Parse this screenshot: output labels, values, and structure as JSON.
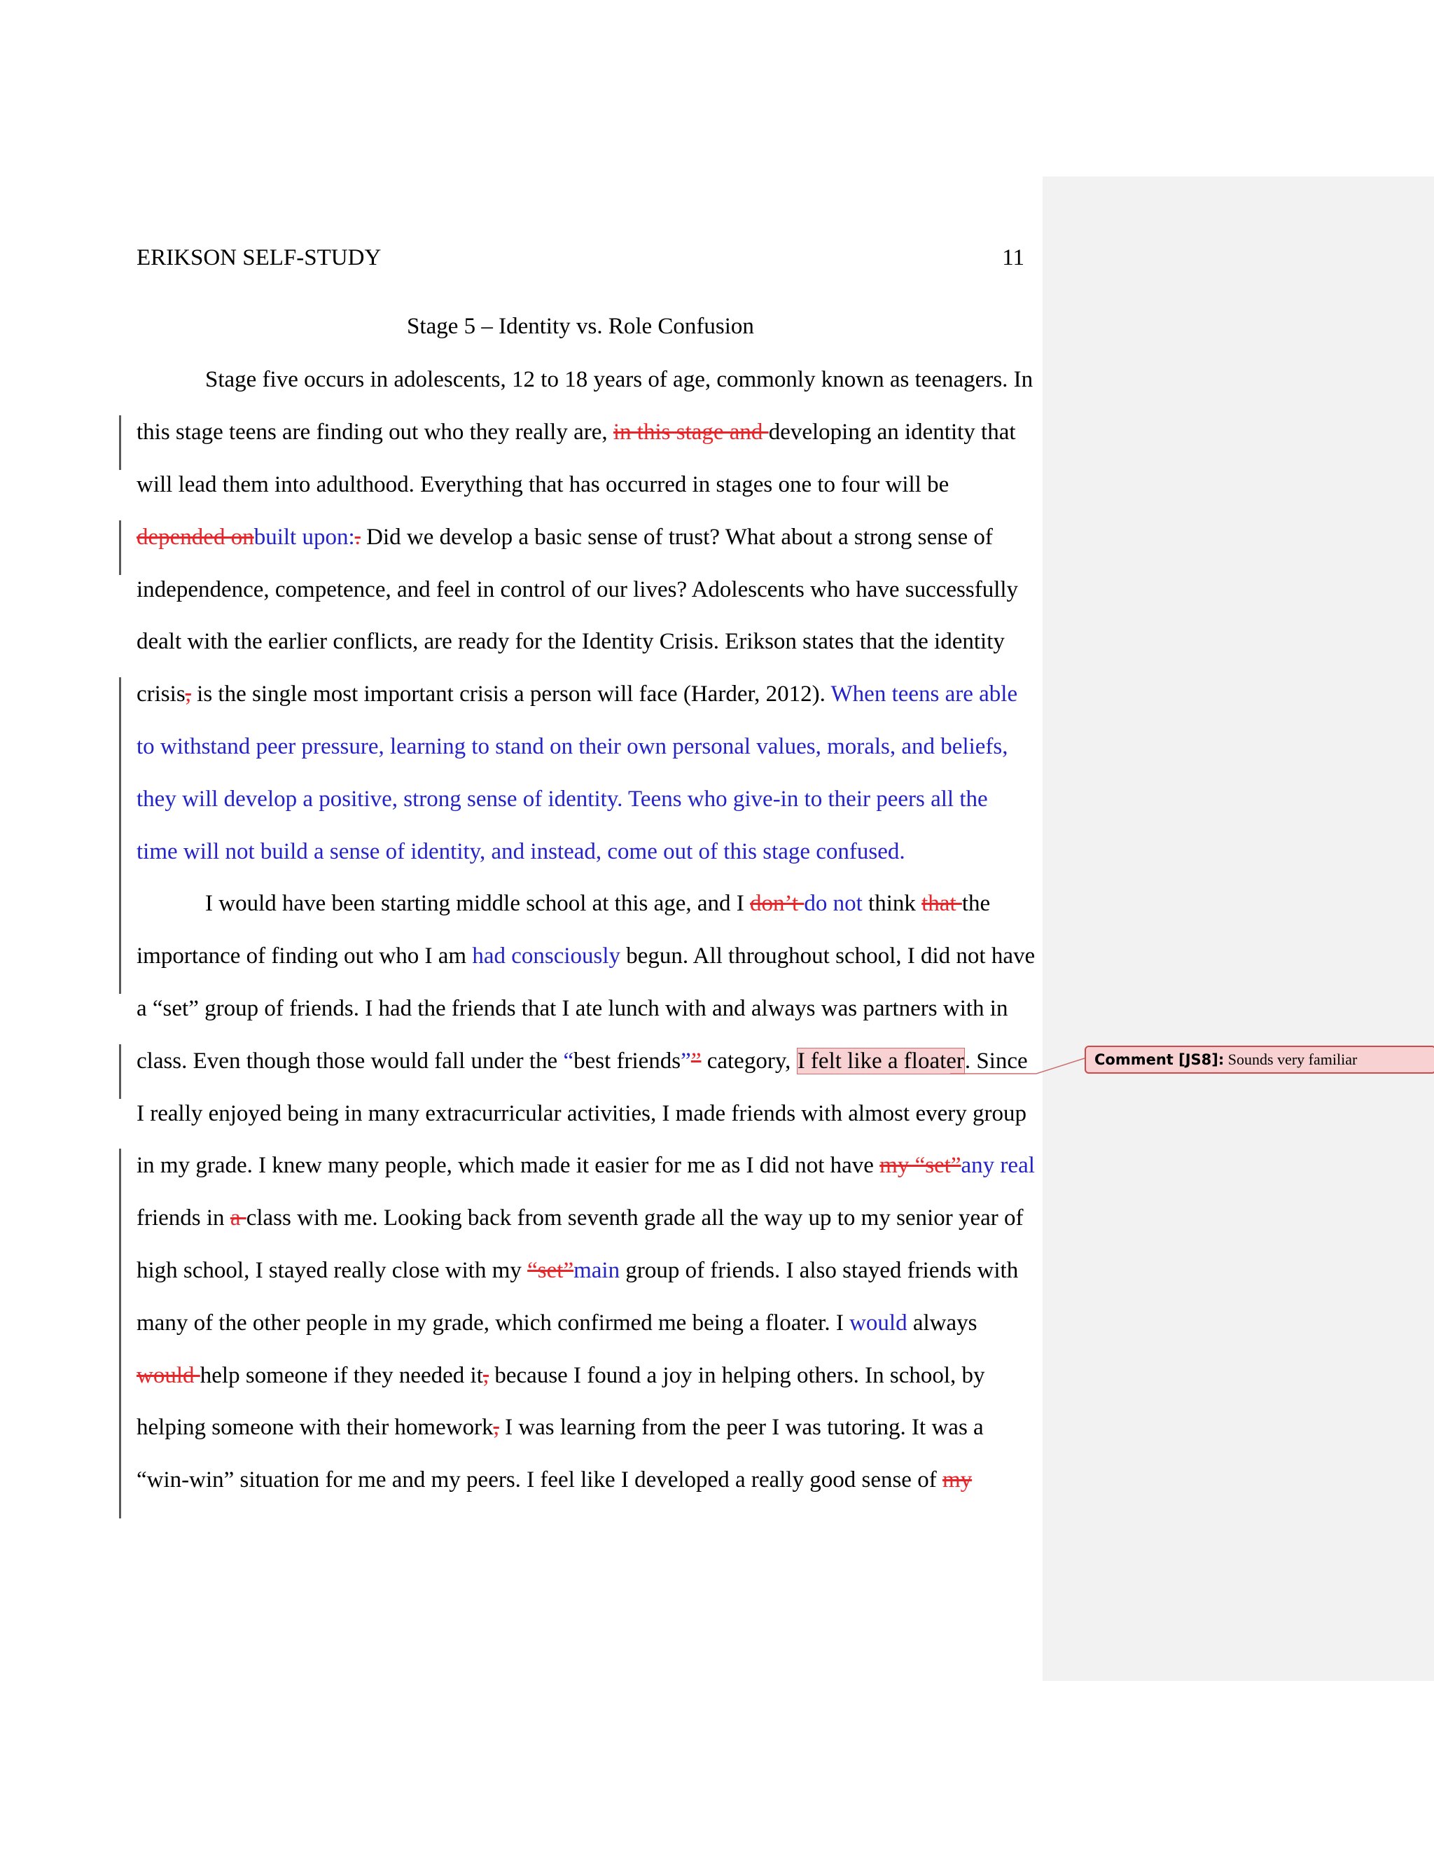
{
  "header": {
    "running_head": "ERIKSON SELF-STUDY",
    "page_number": "11"
  },
  "heading": "Stage 5 – Identity vs. Role Confusion",
  "lines": [
    [
      {
        "t": "Stage five occurs in adolescents, 12 to 18 years of age, commonly known as teenagers. In"
      }
    ],
    [
      {
        "t": "this stage teens are finding out who they really are, "
      },
      {
        "t": "in this stage and ",
        "k": "del"
      },
      {
        "t": "developing an identity that"
      }
    ],
    [
      {
        "t": "will lead them into adulthood. Everything that has occurred in stages one to four will be"
      }
    ],
    [
      {
        "t": "depended on",
        "k": "del"
      },
      {
        "t": "built upon:",
        "k": "ins"
      },
      {
        "t": ".",
        "k": "del"
      },
      {
        "t": " Did we develop a basic sense of trust? What about a strong sense of"
      }
    ],
    [
      {
        "t": "independence, competence, and feel in control of our lives? Adolescents who have successfully"
      }
    ],
    [
      {
        "t": "dealt with the earlier conflicts, are ready for the Identity Crisis. Erikson states that the identity"
      }
    ],
    [
      {
        "t": "crisis"
      },
      {
        "t": ",",
        "k": "del"
      },
      {
        "t": " is the single most important crisis a person will face (Harder, 2012). "
      },
      {
        "t": "When teens are able",
        "k": "ins"
      }
    ],
    [
      {
        "t": "to withstand peer pressure, learning to stand on their own personal values, morals, and beliefs,",
        "k": "ins"
      }
    ],
    [
      {
        "t": "they will develop a positive, strong sense of identity. Teens who give-in to their peers all the",
        "k": "ins"
      }
    ],
    [
      {
        "t": "time will not build a sense of identity, and instead, come out of this stage confused.",
        "k": "ins"
      }
    ],
    [
      {
        "t": "I would have been starting middle school at this age, and I "
      },
      {
        "t": "don’t ",
        "k": "del"
      },
      {
        "t": "do not",
        "k": "ins"
      },
      {
        "t": " think "
      },
      {
        "t": "that ",
        "k": "del"
      },
      {
        "t": "the"
      }
    ],
    [
      {
        "t": "importance of finding out who I am "
      },
      {
        "t": "had consciously",
        "k": "ins"
      },
      {
        "t": " begun. All throughout school, I did not have"
      }
    ],
    [
      {
        "t": "a “set” group of friends. I had the friends that I ate lunch with and always was partners with in"
      }
    ],
    [
      {
        "t": "class. Even though those would fall under the "
      },
      {
        "t": "“",
        "k": "ins"
      },
      {
        "t": "best friends"
      },
      {
        "t": "”",
        "k": "ins"
      },
      {
        "t": "”",
        "k": "del"
      },
      {
        "t": " category, "
      },
      {
        "t": "I felt like a floater",
        "k": "hl"
      },
      {
        "t": ". Since"
      }
    ],
    [
      {
        "t": "I really enjoyed being in many extracurricular activities, I made friends with almost every group"
      }
    ],
    [
      {
        "t": "in my grade. I knew many people, which made it easier for me as I did not have "
      },
      {
        "t": "my “set”",
        "k": "del"
      },
      {
        "t": "any real",
        "k": "ins"
      }
    ],
    [
      {
        "t": "friends in "
      },
      {
        "t": "a ",
        "k": "del"
      },
      {
        "t": "class with me. Looking back from seventh grade all the way up to my senior year of"
      }
    ],
    [
      {
        "t": "high school, I stayed really close with my "
      },
      {
        "t": "“set”",
        "k": "del"
      },
      {
        "t": "main",
        "k": "ins"
      },
      {
        "t": " group of friends. I also stayed friends with"
      }
    ],
    [
      {
        "t": "many of the other people in my grade, which confirmed me being a floater. I "
      },
      {
        "t": "would",
        "k": "ins"
      },
      {
        "t": " always"
      }
    ],
    [
      {
        "t": "would ",
        "k": "del"
      },
      {
        "t": "help someone if they needed it"
      },
      {
        "t": ",",
        "k": "del"
      },
      {
        "t": " because I found a joy in helping others. In school, by"
      }
    ],
    [
      {
        "t": "helping someone with their homework"
      },
      {
        "t": ",",
        "k": "del"
      },
      {
        "t": " I was learning from the peer I was tutoring. It was a"
      }
    ],
    [
      {
        "t": "“win-win” situation for me and my peers. I feel like I developed a really good sense of "
      },
      {
        "t": "my",
        "k": "del"
      }
    ]
  ],
  "comment": {
    "label": "Comment [JS8]:",
    "text": " Sounds very familiar"
  },
  "colors": {
    "deletion": "#e8262a",
    "insertion": "#2323c8",
    "comment_fill": "#f8d2d2",
    "comment_border": "#cc4a4c",
    "pane": "#f2f2f2"
  }
}
